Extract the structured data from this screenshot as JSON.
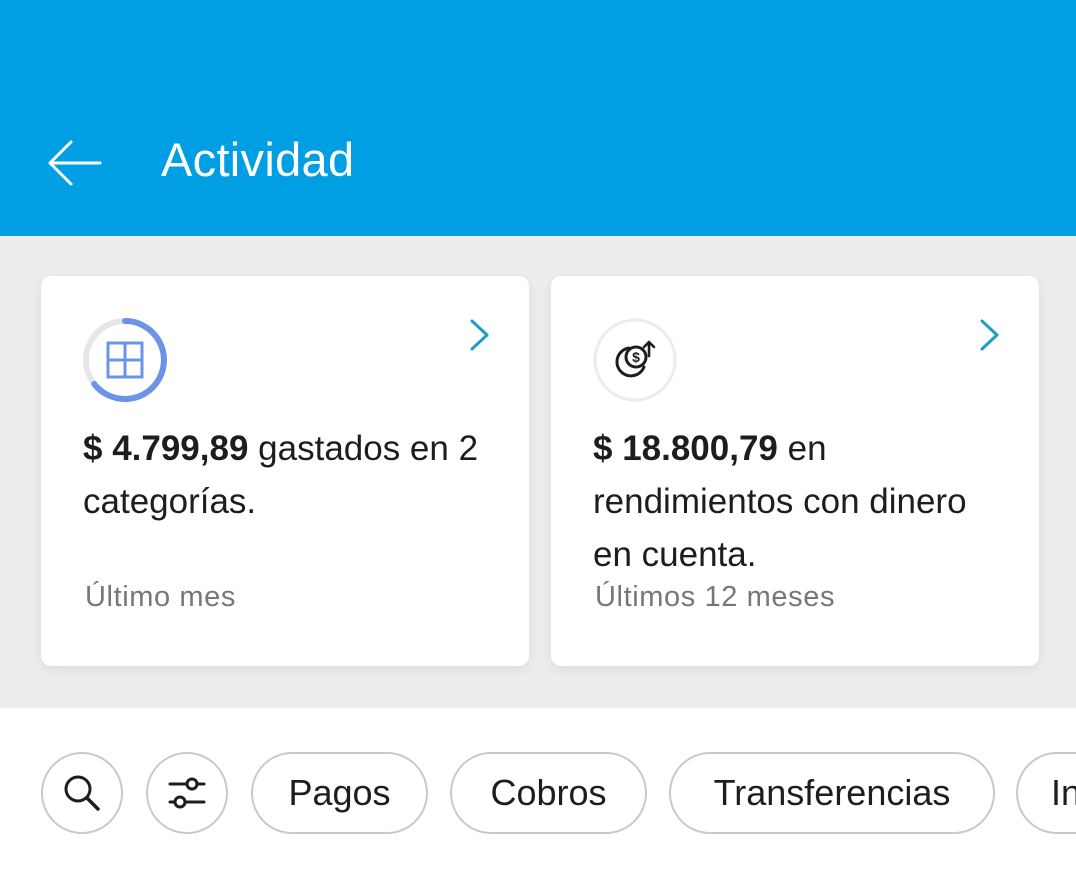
{
  "header": {
    "title": "Actividad",
    "back_icon": "arrow-left-icon",
    "background_color": "#009ee3"
  },
  "cards": [
    {
      "icon": "categories-grid-icon",
      "amount": "$ 4.799,89",
      "text": " gastados en 2 categorías.",
      "period": "Último mes",
      "chevron_icon": "chevron-right-icon"
    },
    {
      "icon": "coin-arrow-up-icon",
      "amount": "$ 18.800,79",
      "text": " en rendimientos con dinero en cuenta.",
      "period": "Últimos 12 meses",
      "chevron_icon": "chevron-right-icon"
    }
  ],
  "filters": {
    "search_icon": "search-icon",
    "filter_icon": "sliders-icon",
    "chips": [
      "Pagos",
      "Cobros",
      "Transferencias",
      "In"
    ]
  },
  "colors": {
    "accent": "#009ee3",
    "ring_progress": "#6b93e6",
    "chevron": "#1a9fc9"
  }
}
